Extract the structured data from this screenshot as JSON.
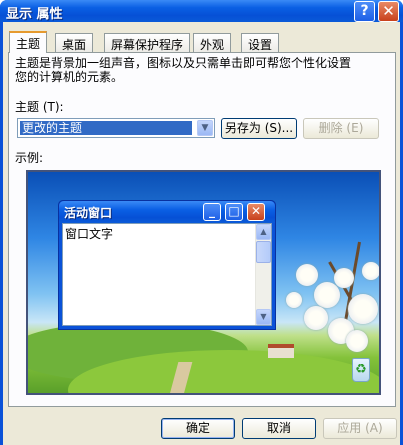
{
  "window": {
    "title": "显示 属性",
    "help_label": "?",
    "close_label": "✕"
  },
  "tabs": [
    {
      "label": "主题",
      "active": true
    },
    {
      "label": "桌面",
      "active": false
    },
    {
      "label": "屏幕保护程序",
      "active": false
    },
    {
      "label": "外观",
      "active": false
    },
    {
      "label": "设置",
      "active": false
    }
  ],
  "theme_page": {
    "description_line1": "主题是背景加一组声音，图标以及只需单击即可帮您个性化设置",
    "description_line2": "您的计算机的元素。",
    "theme_label": "主题 (T):",
    "theme_selected": "更改的主题",
    "save_as_label": "另存为 (S)...",
    "delete_label": "删除 (E)",
    "preview_label": "示例:"
  },
  "preview_window": {
    "title": "活动窗口",
    "body_text": "窗口文字",
    "min_glyph": "_",
    "max_glyph": "□",
    "close_glyph": "✕"
  },
  "footer": {
    "ok_label": "确定",
    "cancel_label": "取消",
    "apply_label": "应用 (A)"
  },
  "colors": {
    "titlebar": "#0a5fe4",
    "dialog_bg": "#ece9d8",
    "selection": "#316ac5",
    "active_tab_accent": "#e69a2e"
  }
}
